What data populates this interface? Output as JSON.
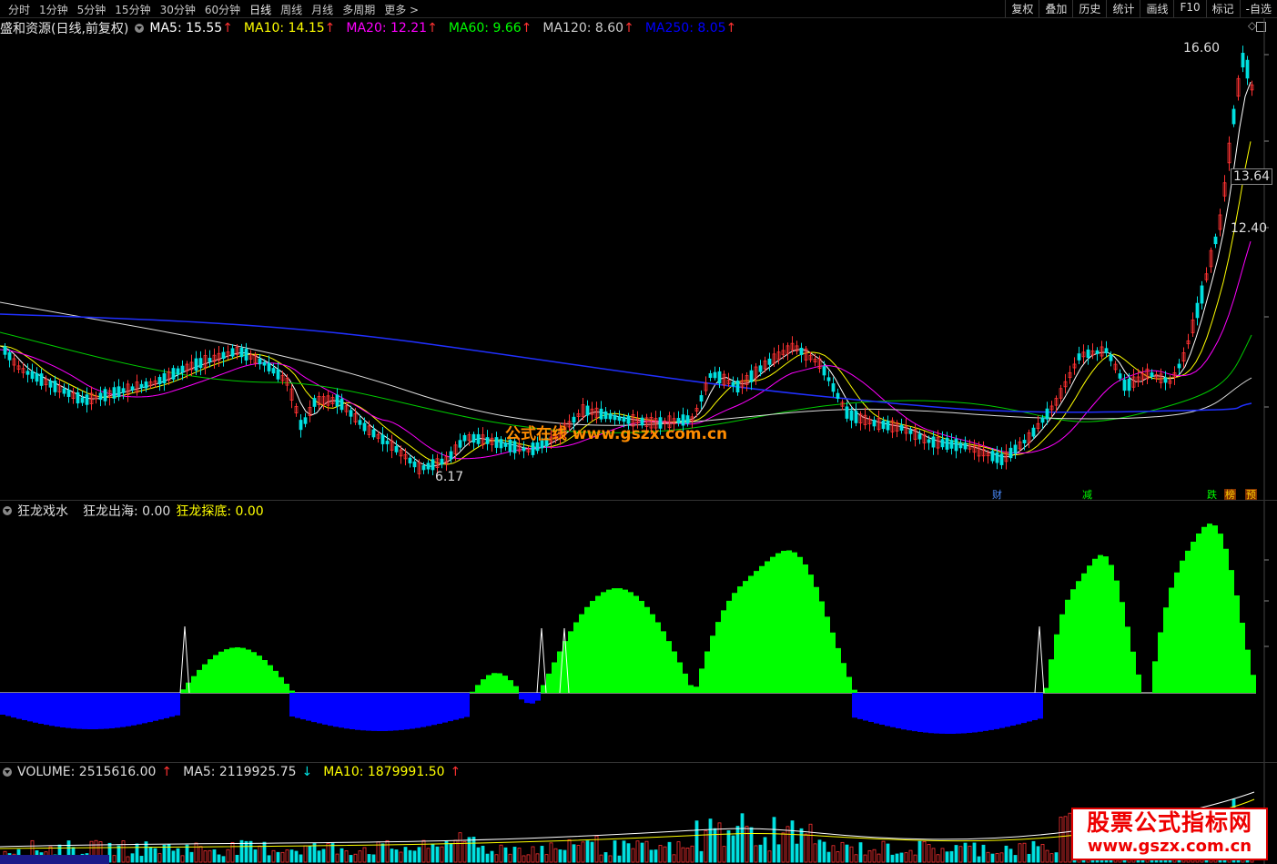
{
  "topbar": {
    "tabs": [
      "分时",
      "1分钟",
      "5分钟",
      "15分钟",
      "30分钟",
      "60分钟",
      "日线",
      "周线",
      "月线",
      "多周期",
      "更多 >"
    ],
    "active_tab": "日线",
    "tools": [
      "复权",
      "叠加",
      "历史",
      "统计",
      "画线",
      "F10",
      "标记",
      "-自选"
    ]
  },
  "main": {
    "title": "盛和资源(日线,前复权)",
    "ma": [
      {
        "label": "MA5: 15.55",
        "color": "#ffffff"
      },
      {
        "label": "MA10: 14.15",
        "color": "#ffff00"
      },
      {
        "label": "MA20: 12.21",
        "color": "#ff00ff"
      },
      {
        "label": "MA60: 9.66",
        "color": "#00ff00"
      },
      {
        "label": "MA120: 8.60",
        "color": "#cccccc"
      },
      {
        "label": "MA250: 8.05",
        "color": "#0000ff"
      }
    ],
    "high_label": "16.60",
    "low_label": "6.17",
    "axis_labels": [
      "13.64",
      "12.40"
    ],
    "events": [
      {
        "text": "财",
        "color": "#4a8cff",
        "bg": "#000"
      },
      {
        "text": "减",
        "color": "#00ff00",
        "bg": "#000"
      },
      {
        "text": "跌",
        "color": "#00ff00",
        "bg": "#000"
      },
      {
        "text": "榜",
        "color": "#ffcc00",
        "bg": "#803000"
      },
      {
        "text": "预",
        "color": "#ffcc00",
        "bg": "#803000"
      }
    ],
    "diamond": "◇"
  },
  "indicator": {
    "name": "狂龙戏水",
    "l1": "狂龙出海: 0.00",
    "l2": "狂龙探底: 0.00"
  },
  "volume": {
    "label": "VOLUME: 2515616.00",
    "ma5": "MA5: 2119925.75",
    "ma10": "MA10: 1879991.50"
  },
  "watermark": "公式在线   www.gszx.com.cn",
  "logo": {
    "line1": "股票公式指标网",
    "line2": "www.gszx.com.cn"
  },
  "colors": {
    "up": "#ff3232",
    "down": "#00e0e0",
    "pos": "#00ff00",
    "neg": "#0000ff"
  }
}
